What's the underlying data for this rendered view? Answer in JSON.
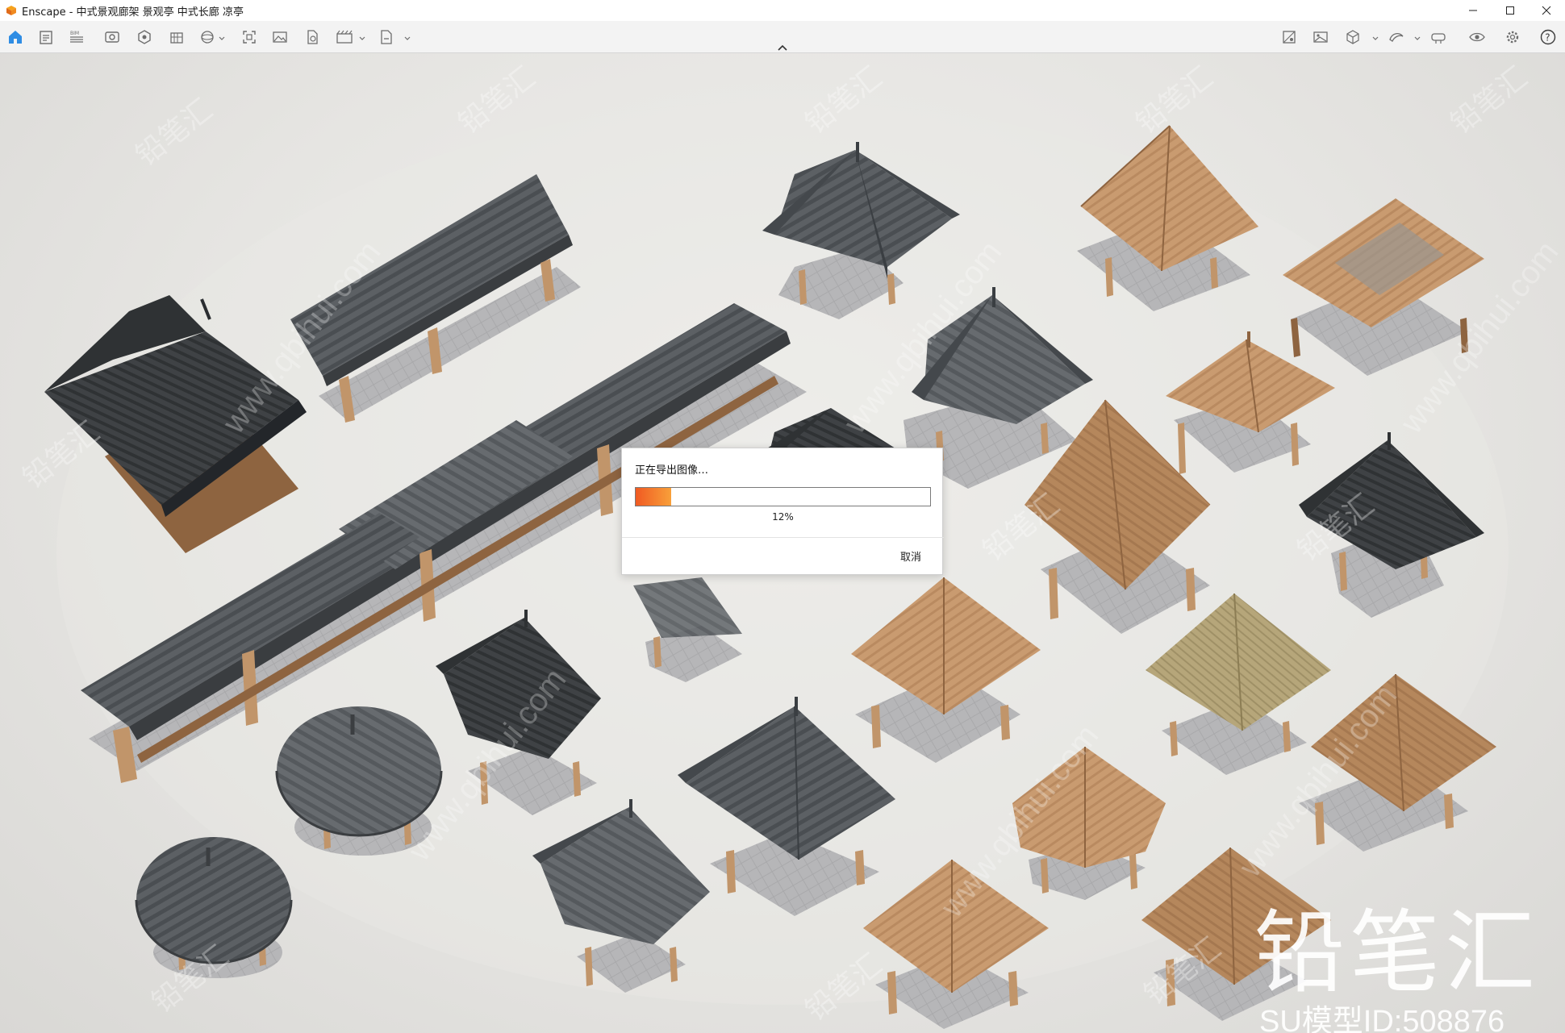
{
  "window": {
    "title": "Enscape - 中式景观廊架 景观亭 中式长廊 凉亭"
  },
  "toolbar": {
    "left_icons": [
      "home-icon",
      "document-icon",
      "bim-icon",
      "visual-settings-icon",
      "asset-library-icon",
      "building-icon",
      "views-icon",
      "screenshot-icon",
      "image-export-icon",
      "batch-render-icon",
      "video-export-icon",
      "exe-export-icon"
    ],
    "right_icons": [
      "material-editor-icon",
      "image-icon",
      "cube-icon",
      "vr-icon",
      "headset-icon",
      "visibility-icon",
      "settings-icon",
      "help-icon"
    ]
  },
  "dialog": {
    "message": "正在导出图像…",
    "progress": 0.12,
    "progress_text": "12%",
    "cancel_label": "取消",
    "accent_start": "#f05a22",
    "accent_end": "#f8a03a"
  },
  "watermark": {
    "brand": "铅笔汇",
    "model_id": "SU模型ID:508876",
    "url": "www.qbihui.com"
  },
  "colors": {
    "background": "#e6e5e3",
    "roof_gray": "#5a5e62",
    "roof_dark": "#3b3e41",
    "wood": "#c89a6e",
    "wood_dark": "#8e6440",
    "stone": "#a8a8aa",
    "thatch": "#b7a77a"
  }
}
